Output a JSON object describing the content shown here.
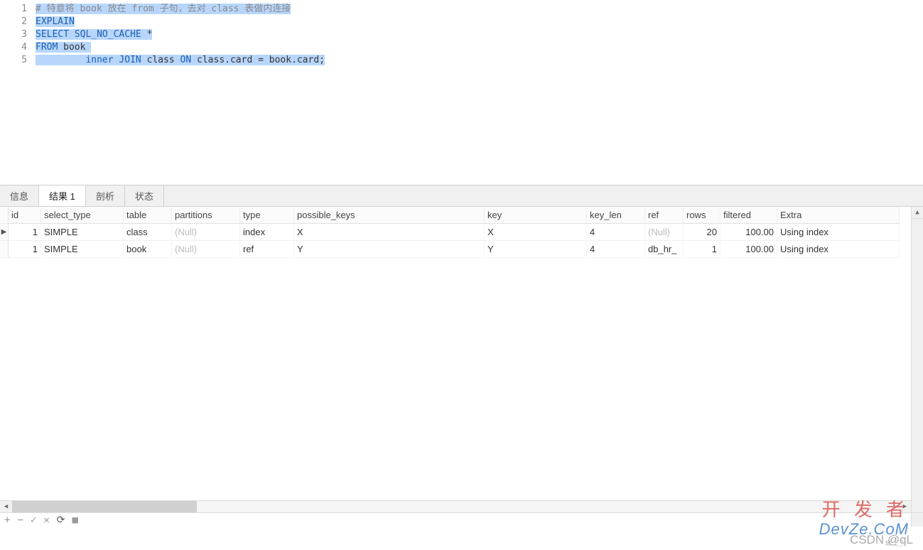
{
  "editor": {
    "lineNumbers": [
      "1",
      "2",
      "3",
      "4",
      "5"
    ],
    "lines": {
      "l1_comment": "# 特意将 book 放在 from 子句，去对 class 表做内连接",
      "l2_explain": "EXPLAIN",
      "l3_select": "SELECT",
      "l3_nocache": "SQL_NO_CACHE",
      "l3_star": " *",
      "l4_from": "FROM",
      "l4_book": " book ",
      "l5_pad": "         ",
      "l5_inner": "inner",
      "l5_join": "JOIN",
      "l5_class": " class ",
      "l5_on": "ON",
      "l5_cond": " class.card = book.card;"
    }
  },
  "tabs": {
    "info": "信息",
    "result": "结果 1",
    "analysis": "剖析",
    "status": "状态"
  },
  "columns": [
    "id",
    "select_type",
    "table",
    "partitions",
    "type",
    "possible_keys",
    "key",
    "key_len",
    "ref",
    "rows",
    "filtered",
    "Extra"
  ],
  "rows": [
    {
      "id": "1",
      "select_type": "SIMPLE",
      "table": "class",
      "partitions": "(Null)",
      "type": "index",
      "possible_keys": "X",
      "key": "X",
      "key_len": "4",
      "ref": "(Null)",
      "rows": "20",
      "filtered": "100.00",
      "Extra": "Using index"
    },
    {
      "id": "1",
      "select_type": "SIMPLE",
      "table": "book",
      "partitions": "(Null)",
      "type": "ref",
      "possible_keys": "Y",
      "key": "Y",
      "key_len": "4",
      "ref": "db_hr_",
      "rows": "1",
      "filtered": "100.00",
      "Extra": "Using index"
    }
  ],
  "toolbar": {
    "plus": "+",
    "minus": "−",
    "check": "✓",
    "x": "✕",
    "refresh": "⟳",
    "stop": "■"
  },
  "watermark": {
    "kfz": "开 发 者",
    "devze": "DevZe.CoM",
    "csdn": "CSDN @qL"
  },
  "status": {
    "grid": "⊞",
    "img": "🖵"
  }
}
